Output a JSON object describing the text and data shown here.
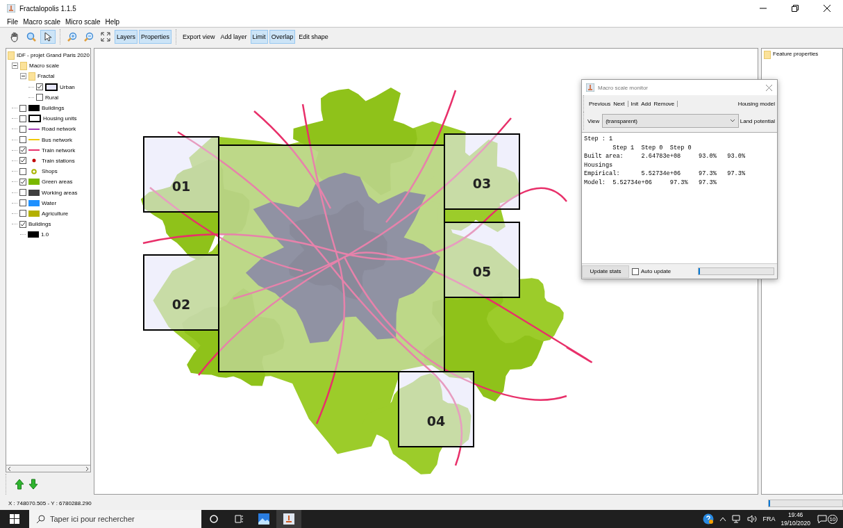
{
  "window": {
    "title": "Fractalopolis 1.1.5"
  },
  "menu": [
    "File",
    "Macro scale",
    "Micro scale",
    "Help"
  ],
  "toolbar": [
    {
      "kind": "icon",
      "selected": false
    },
    {
      "kind": "icon",
      "selected": false
    },
    {
      "kind": "icon",
      "selected": true
    },
    {
      "kind": "sep"
    },
    {
      "kind": "icon",
      "selected": false
    },
    {
      "kind": "icon",
      "selected": false
    },
    {
      "kind": "icon",
      "selected": false
    },
    {
      "kind": "toggle",
      "label": "Layers",
      "selected": true
    },
    {
      "kind": "toggle",
      "label": "Properties",
      "selected": true
    },
    {
      "kind": "sep"
    },
    {
      "kind": "toggle",
      "label": "Export view",
      "selected": false
    },
    {
      "kind": "toggle",
      "label": "Add layer",
      "selected": false
    },
    {
      "kind": "toggle",
      "label": "Limit",
      "selected": true
    },
    {
      "kind": "toggle",
      "label": "Overlap",
      "selected": true
    },
    {
      "kind": "toggle",
      "label": "Edit shape",
      "selected": false
    }
  ],
  "layers": {
    "label": "IDF - projet Grand Paris 2020",
    "children": [
      {
        "kind": "folder",
        "label": "Macro scale",
        "expanded": true,
        "children": [
          {
            "kind": "folder",
            "label": "Fractal",
            "expanded": true,
            "children": [
              {
                "kind": "layer",
                "label": "Urban",
                "checked": true,
                "symbol": {
                  "kind": "frame",
                  "color": "#e6e6fa"
                }
              },
              {
                "kind": "layer",
                "label": "Rural",
                "checked": false
              }
            ]
          }
        ]
      },
      {
        "kind": "layer",
        "label": "Buildings",
        "checked": false,
        "symbol": {
          "kind": "fill",
          "color": "#000000"
        }
      },
      {
        "kind": "layer",
        "label": "Housing units",
        "checked": false,
        "symbol": {
          "kind": "frame",
          "color": "#ffffff"
        }
      },
      {
        "kind": "layer",
        "label": "Road network",
        "checked": false,
        "symbol": {
          "kind": "line",
          "color": "#a03cb4"
        }
      },
      {
        "kind": "layer",
        "label": "Bus network",
        "checked": false,
        "symbol": {
          "kind": "line",
          "color": "#f0c800"
        }
      },
      {
        "kind": "layer",
        "label": "Train network",
        "checked": true,
        "symbol": {
          "kind": "line",
          "color": "#e8306a"
        }
      },
      {
        "kind": "layer",
        "label": "Train stations",
        "checked": true,
        "symbol": {
          "kind": "dot",
          "color": "#c00000"
        }
      },
      {
        "kind": "layer",
        "label": "Shops",
        "checked": false,
        "symbol": {
          "kind": "ring",
          "color": "#a8b400"
        }
      },
      {
        "kind": "layer",
        "label": "Green areas",
        "checked": true,
        "symbol": {
          "kind": "fill",
          "color": "#7ab800"
        }
      },
      {
        "kind": "layer",
        "label": "Working areas",
        "checked": false,
        "symbol": {
          "kind": "fill",
          "color": "#404040"
        }
      },
      {
        "kind": "layer",
        "label": "Water",
        "checked": false,
        "symbol": {
          "kind": "fill",
          "color": "#1e90ff"
        }
      },
      {
        "kind": "layer",
        "label": "Agriculture",
        "checked": false,
        "symbol": {
          "kind": "fill",
          "color": "#b4b000"
        }
      },
      {
        "kind": "layer",
        "label": "Buildings",
        "checked": true,
        "children": [
          {
            "kind": "legend",
            "label": "1.0",
            "symbol": {
              "kind": "fill",
              "color": "#000000"
            }
          }
        ]
      }
    ]
  },
  "map": {
    "zones": [
      {
        "label": "01"
      },
      {
        "label": "02"
      },
      {
        "label": "03"
      },
      {
        "label": "05"
      },
      {
        "label": "04"
      }
    ]
  },
  "properties_panel": {
    "title": "Feature properties"
  },
  "monitor": {
    "title": "Macro scale monitor",
    "buttons": [
      [
        "Previous",
        "Next"
      ],
      [
        "Init",
        "Add",
        "Remove"
      ]
    ],
    "model_label": "Housing model",
    "view_label": "View",
    "view_value": "(transparent)",
    "potential_label": "Land potential",
    "output": [
      "Step : 1",
      "        Step 1  Step 0  Step 0",
      "Built area:     2.64783e+08     93.0%   93.0%",
      "Housings",
      "Empirical:      5.52734e+06     97.3%   97.3%",
      "Model:  5.52734e+06     97.3%   97.3%"
    ],
    "update_button": "Update stats",
    "auto_update": {
      "label": "Auto update",
      "checked": false
    },
    "progress": {
      "level": 0.0
    }
  },
  "status_bar": {
    "coordinates": "X : 748070.505 - Y : 6780288.290",
    "progress": {
      "level": 0.0
    }
  },
  "taskbar": {
    "search_placeholder": "Taper ici pour rechercher",
    "language": "FRA",
    "time": "19:46",
    "date": "19/10/2020",
    "notifications": "10"
  }
}
